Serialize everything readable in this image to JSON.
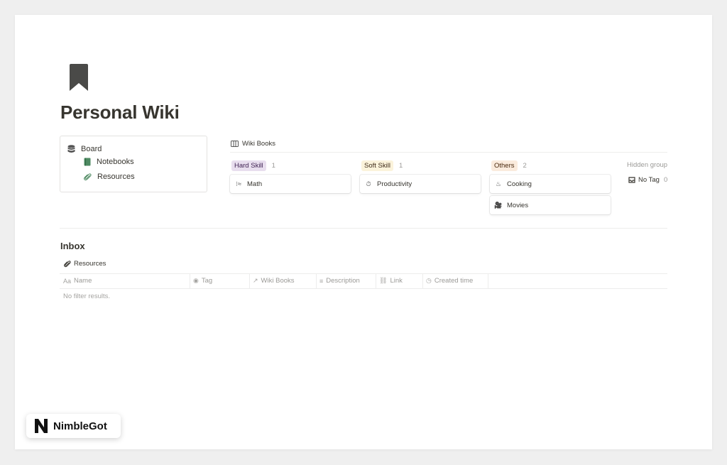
{
  "page": {
    "title": "Personal Wiki",
    "icon": "bookmark-icon"
  },
  "sidebar": {
    "items": [
      {
        "label": "Board",
        "icon": "database-icon"
      },
      {
        "label": "Notebooks",
        "icon": "notebook-icon"
      },
      {
        "label": "Resources",
        "icon": "paperclip-icon"
      }
    ]
  },
  "board": {
    "title": "Wiki Books",
    "icon": "board-view-icon",
    "columns": [
      {
        "tag": "Hard Skill",
        "count": "1",
        "color": "#e8deee",
        "text_color": "#412454",
        "cards": [
          {
            "label": "Math",
            "icon": "calculator-icon"
          }
        ]
      },
      {
        "tag": "Soft Skill",
        "count": "1",
        "color": "#fbf3db",
        "text_color": "#402c1b",
        "cards": [
          {
            "label": "Productivity",
            "icon": "stopwatch-icon"
          }
        ]
      },
      {
        "tag": "Others",
        "count": "2",
        "color": "#faebdd",
        "text_color": "#49290e",
        "cards": [
          {
            "label": "Cooking",
            "icon": "cooking-pot-icon"
          },
          {
            "label": "Movies",
            "icon": "film-camera-icon"
          }
        ]
      }
    ],
    "hidden_groups_label": "Hidden group",
    "no_tag": {
      "label": "No Tag",
      "count": "0",
      "icon": "inbox-icon"
    }
  },
  "inbox": {
    "title": "Inbox",
    "view_tab": "Resources",
    "columns": [
      {
        "prefix": "Aa",
        "label": "Name"
      },
      {
        "icon": "status-icon",
        "label": "Tag"
      },
      {
        "icon": "relation-arrow-icon",
        "label": "Wiki Books"
      },
      {
        "icon": "text-lines-icon",
        "label": "Description"
      },
      {
        "icon": "link-icon",
        "label": "Link"
      },
      {
        "icon": "clock-icon",
        "label": "Created time"
      }
    ],
    "empty_message": "No filter results."
  },
  "watermark": {
    "text": "NimbleGot",
    "logo_letter": "N"
  }
}
